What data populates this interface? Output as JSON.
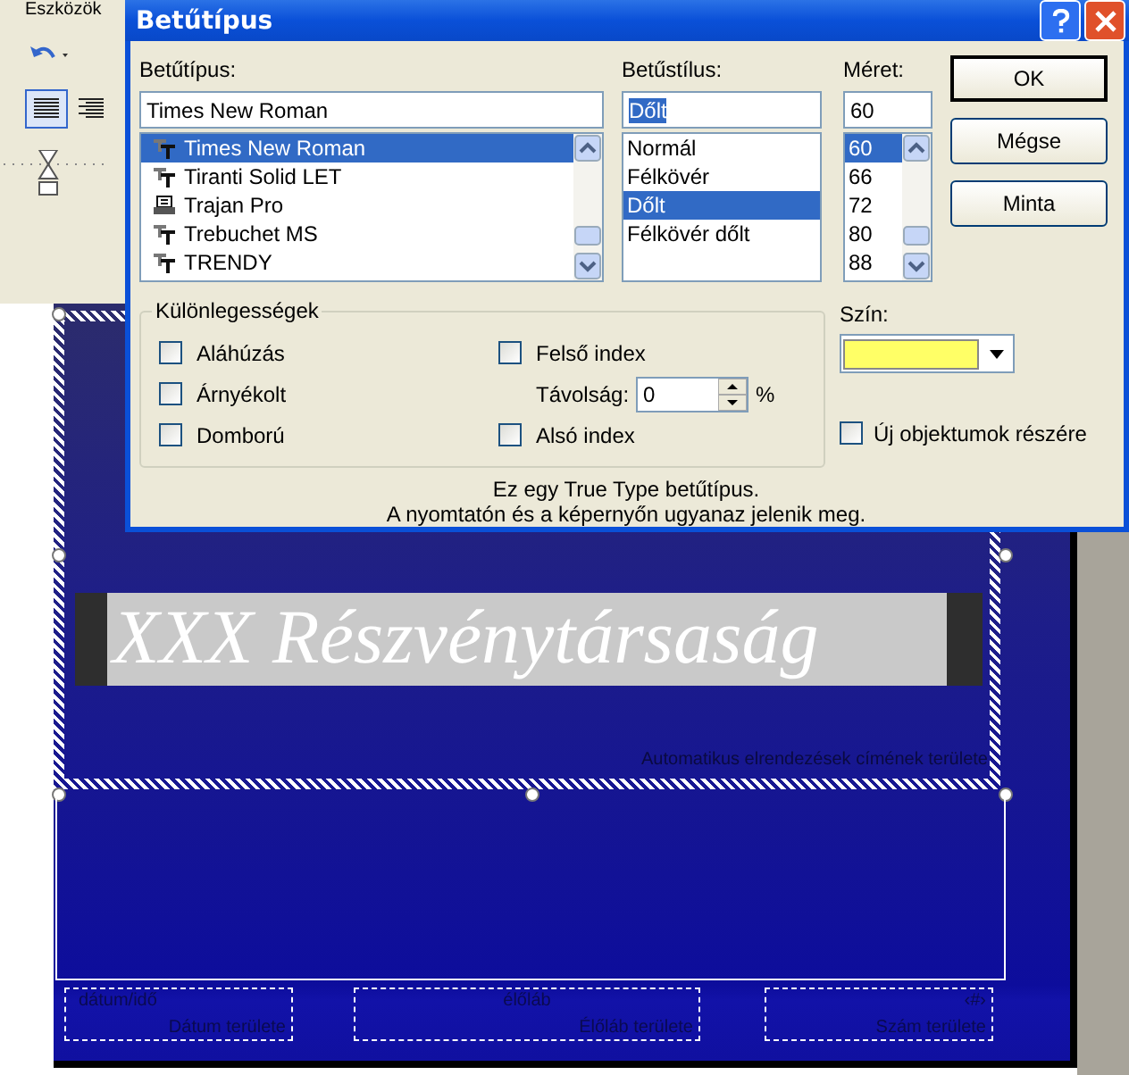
{
  "app": {
    "menu_item": "Eszközök"
  },
  "dialog": {
    "title": "Betűtípus",
    "font": {
      "label": "Betűtípus:",
      "value": "Times New Roman",
      "items": [
        {
          "name": "Times New Roman",
          "kind": "truetype",
          "selected": true
        },
        {
          "name": "Tiranti Solid LET",
          "kind": "truetype",
          "selected": false
        },
        {
          "name": "Trajan Pro",
          "kind": "printer",
          "selected": false
        },
        {
          "name": "Trebuchet MS",
          "kind": "truetype",
          "selected": false
        },
        {
          "name": "TRENDY",
          "kind": "truetype",
          "selected": false
        }
      ]
    },
    "style": {
      "label": "Betűstílus:",
      "value": "Dőlt",
      "items": [
        {
          "name": "Normál",
          "selected": false
        },
        {
          "name": "Félkövér",
          "selected": false
        },
        {
          "name": "Dőlt",
          "selected": true
        },
        {
          "name": "Félkövér dőlt",
          "selected": false
        }
      ]
    },
    "size": {
      "label": "Méret:",
      "value": "60",
      "items": [
        {
          "name": "60",
          "selected": true
        },
        {
          "name": "66",
          "selected": false
        },
        {
          "name": "72",
          "selected": false
        },
        {
          "name": "80",
          "selected": false
        },
        {
          "name": "88",
          "selected": false
        }
      ]
    },
    "buttons": [
      {
        "label": "OK",
        "default": true
      },
      {
        "label": "Mégse",
        "default": false
      },
      {
        "label": "Minta",
        "default": false
      }
    ],
    "effects": {
      "title": "Különlegességek",
      "left": [
        {
          "kind": "checkbox",
          "label": "Aláhúzás",
          "checked": false
        },
        {
          "kind": "checkbox",
          "label": "Árnyékolt",
          "checked": false
        },
        {
          "kind": "checkbox",
          "label": "Domború",
          "checked": false
        }
      ],
      "right": [
        {
          "kind": "checkbox",
          "label": "Felső index",
          "checked": false
        },
        {
          "kind": "spin",
          "label": "Távolság:",
          "value": "0",
          "unit": "%"
        },
        {
          "kind": "checkbox",
          "label": "Alsó index",
          "checked": false
        }
      ]
    },
    "color": {
      "label": "Szín:",
      "color": "#ffff66"
    },
    "default_option": {
      "label": "Új objektumok részére",
      "checked": false
    },
    "info": [
      "Ez egy True Type betűtípus.",
      "A nyomtatón és a képernyőn ugyanaz jelenik meg."
    ]
  },
  "slide": {
    "title": "XXX Részvénytársaság",
    "title_area_label": "Automatikus elrendezések címének területe",
    "footer": [
      {
        "field": "dátum/idő",
        "label": "Dátum területe"
      },
      {
        "field": "élőláb",
        "label": "Élőláb területe"
      },
      {
        "field": "‹#›",
        "label": "Szám területe"
      }
    ]
  }
}
